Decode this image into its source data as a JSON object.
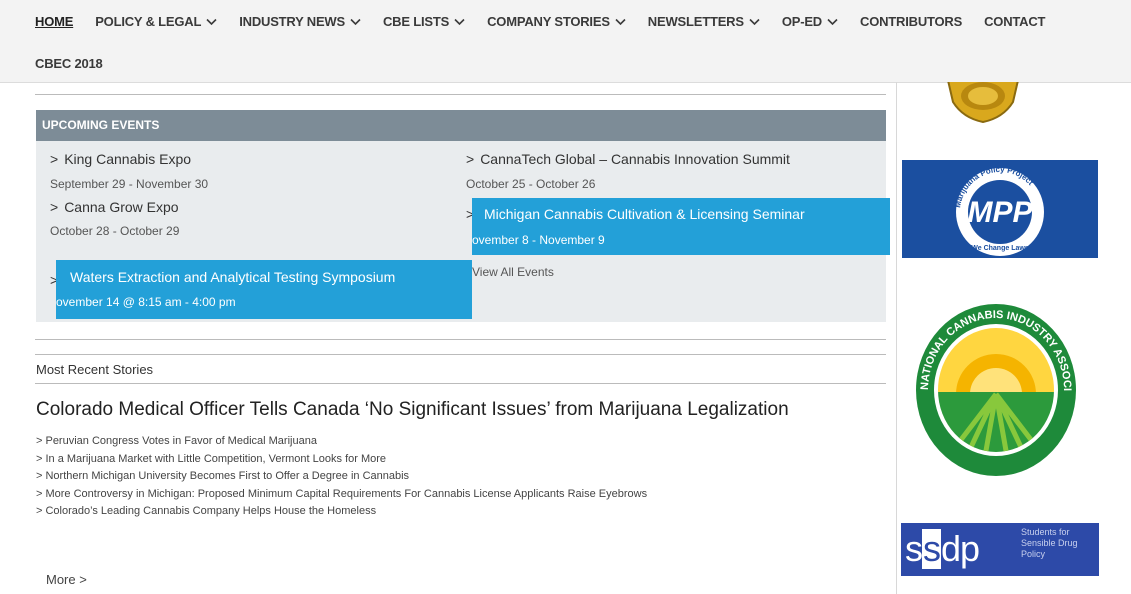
{
  "nav": {
    "items": [
      {
        "label": "HOME",
        "active": true,
        "dropdown": false
      },
      {
        "label": "POLICY & LEGAL",
        "active": false,
        "dropdown": true
      },
      {
        "label": "INDUSTRY NEWS",
        "active": false,
        "dropdown": true
      },
      {
        "label": "CBE LISTS",
        "active": false,
        "dropdown": true
      },
      {
        "label": "COMPANY STORIES",
        "active": false,
        "dropdown": true
      },
      {
        "label": "NEWSLETTERS",
        "active": false,
        "dropdown": true
      },
      {
        "label": "OP-ED",
        "active": false,
        "dropdown": true
      },
      {
        "label": "CONTRIBUTORS",
        "active": false,
        "dropdown": false
      },
      {
        "label": "CONTACT",
        "active": false,
        "dropdown": false
      }
    ],
    "row2_label": "CBEC 2018"
  },
  "events": {
    "header": "UPCOMING EVENTS",
    "arrow": ">",
    "items": [
      {
        "title": "King Cannabis Expo",
        "date": "September 29 - November 30"
      },
      {
        "title": "CannaTech Global – Cannabis Innovation Summit",
        "date": "October 25 - October 26"
      },
      {
        "title": "Canna Grow Expo",
        "date": "October 28 - October 29"
      },
      {
        "title": "Michigan Cannabis Cultivation & Licensing Seminar",
        "date": "ovember 8 - November 9"
      },
      {
        "title": "Waters Extraction and Analytical Testing Symposium",
        "date": "ovember 14 @ 8:15 am - 4:00 pm"
      }
    ],
    "view_all": "View All Events"
  },
  "recent": {
    "label": "Most Recent Stories",
    "headline": "Colorado Medical Officer Tells Canada ‘No Significant Issues’ from Marijuana Legalization",
    "stories": [
      "> Peruvian Congress Votes in Favor of Medical Marijuana",
      "> In a Marijuana Market with Little Competition, Vermont Looks for More",
      "> Northern Michigan University Becomes First to Offer a Degree in Cannabis",
      "> More Controversy in Michigan: Proposed Minimum Capital Requirements For Cannabis License Applicants Raise Eyebrows",
      "> Colorado’s Leading Cannabis Company Helps House the Homeless"
    ],
    "more": "More >"
  },
  "sidebar": {
    "mpp": {
      "arc_text": "Marijuana Policy Project",
      "initials": "MPP",
      "tagline": "We Change Laws"
    },
    "ncia": {
      "arc_text": "NATIONAL CANNABIS INDUSTRY ASSOCIATION"
    },
    "ssdp": {
      "word_a": "s",
      "word_b": "s",
      "word_c": "dp",
      "tagline": "Students for Sensible Drug Policy"
    }
  },
  "colors": {
    "event_header": "#7d8c97",
    "event_highlight": "#23a0d8",
    "events_bg": "#e9ecee",
    "mpp_blue": "#1b4fa0",
    "ncia_green": "#1e8a3a",
    "ncia_sun": "#f5b400",
    "ssdp_blue": "#2d4aa8"
  }
}
